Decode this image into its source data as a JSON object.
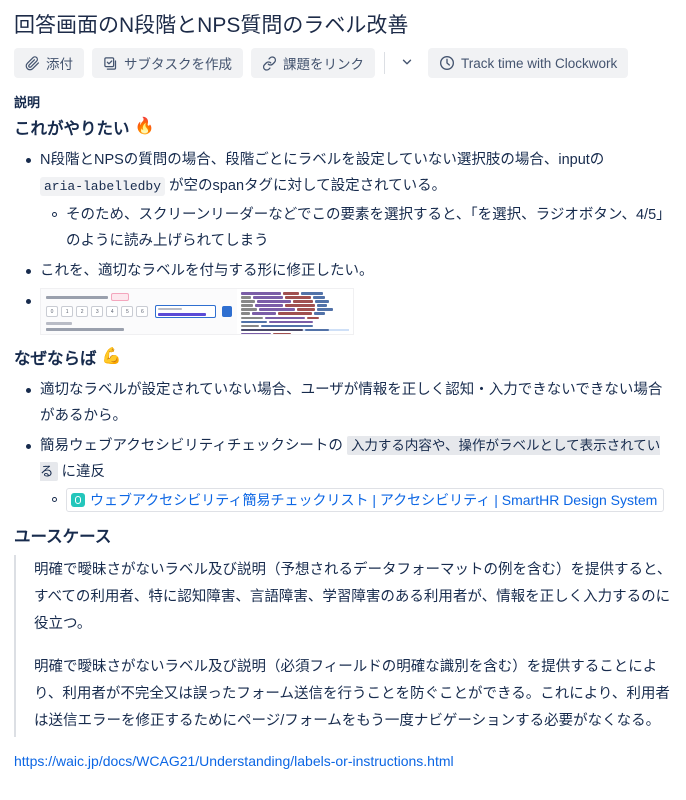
{
  "issue": {
    "title": "回答画面のN段階とNPS質問のラベル改善"
  },
  "toolbar": {
    "attach_label": "添付",
    "attach_icon": "paperclip-icon",
    "subtask_label": "サブタスクを作成",
    "subtask_icon": "checkbox-task-icon",
    "link_label": "課題をリンク",
    "link_icon": "link-chain-icon",
    "more_icon": "chevron-down-icon",
    "clockwork_label": "Track time with Clockwork",
    "clockwork_icon": "clock-icon"
  },
  "description": {
    "field_label": "説明",
    "section1": {
      "heading": "これがやりたい",
      "emoji": "🔥",
      "bullets": [
        {
          "parts": [
            {
              "type": "text",
              "value": "N段階とNPSの質問の場合、段階ごとにラベルを設定していない選択肢の場合、inputの "
            },
            {
              "type": "code",
              "value": "aria-labelledby"
            },
            {
              "type": "text",
              "value": " が空のspanタグに対して設定されている。"
            }
          ],
          "sub": [
            "そのため、スクリーンリーダーなどでこの要素を選択すると、「を選択、ラジオボタン、4/5」のように読み上げられてしまう"
          ]
        },
        {
          "parts": [
            {
              "type": "text",
              "value": "これを、適切なラベルを付与する形に修正したい。"
            }
          ],
          "sub": []
        }
      ],
      "media_alt": "回答画面のN段階質問とaria-labelledby属性のコードを並べたスクリーンショット"
    },
    "section2": {
      "heading": "なぜならば",
      "emoji": "💪",
      "bullet1": "適切なラベルが設定されていない場合、ユーザが情報を正しく認知・入力できないできない場合があるから。",
      "bullet2_pre": "簡易ウェブアクセシビリティチェックシートの ",
      "bullet2_highlight": "入力する内容や、操作がラベルとして表示されている",
      "bullet2_post": " に違反",
      "smartlink": "ウェブアクセシビリティ簡易チェックリスト | アクセシビリティ | SmartHR Design System",
      "smartlink_favicon": "smarthr-favicon-icon"
    },
    "section3": {
      "heading": "ユースケース",
      "quote_p1": "明確で曖昧さがないラベル及び説明（予想されるデータフォーマットの例を含む）を提供すると、すべての利用者、特に認知障害、言語障害、学習障害のある利用者が、情報を正しく入力するのに役立つ。",
      "quote_p2": "明確で曖昧さがないラベル及び説明（必須フィールドの明確な識別を含む）を提供することにより、利用者が不完全又は誤ったフォーム送信を行うことを防ぐことができる。これにより、利用者は送信エラーを修正するためにページ/フォームをもう一度ナビゲーションする必要がなくなる。",
      "source_link": "https://waic.jp/docs/WCAG21/Understanding/labels-or-instructions.html"
    }
  },
  "colors": {
    "text": "#172b4d",
    "link": "#0c66e4",
    "button_bg": "#f1f2f4",
    "button_text": "#44546f",
    "code_bg": "#f1f2f4",
    "quote_border": "#dcdfe4",
    "favicon": "#23c6bb"
  }
}
